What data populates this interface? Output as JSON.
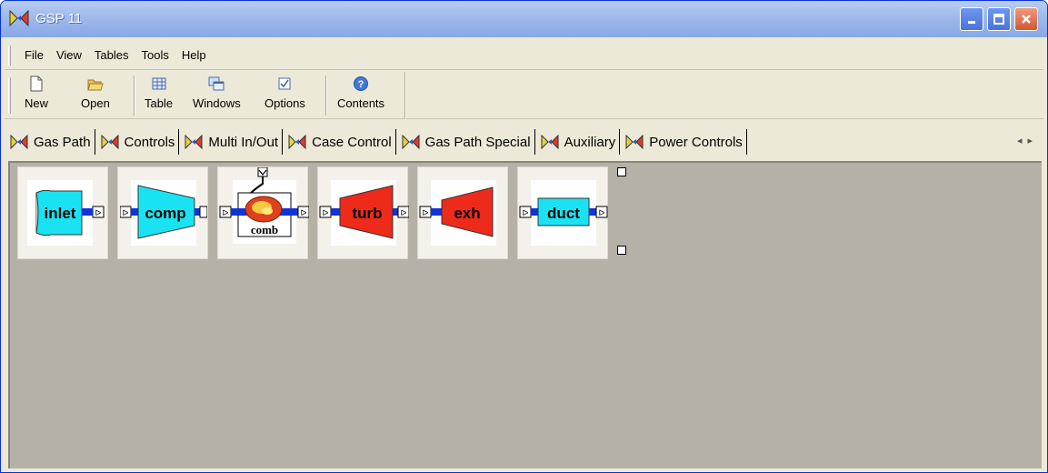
{
  "window": {
    "title": "GSP 11"
  },
  "menu": [
    "File",
    "View",
    "Tables",
    "Tools",
    "Help"
  ],
  "toolbar": {
    "new": "New",
    "open": "Open",
    "table": "Table",
    "windows": "Windows",
    "options": "Options",
    "contents": "Contents"
  },
  "tabs": [
    "Gas Path",
    "Controls",
    "Multi In/Out",
    "Case Control",
    "Gas Path Special",
    "Auxiliary",
    "Power Controls"
  ],
  "components": {
    "inlet": "inlet",
    "comp": "comp",
    "comb": "comb",
    "turb": "turb",
    "exh": "exh",
    "duct": "duct"
  },
  "colors": {
    "cyan": "#19e3f2",
    "red": "#ee2a1b",
    "flow": "#1034d8"
  }
}
